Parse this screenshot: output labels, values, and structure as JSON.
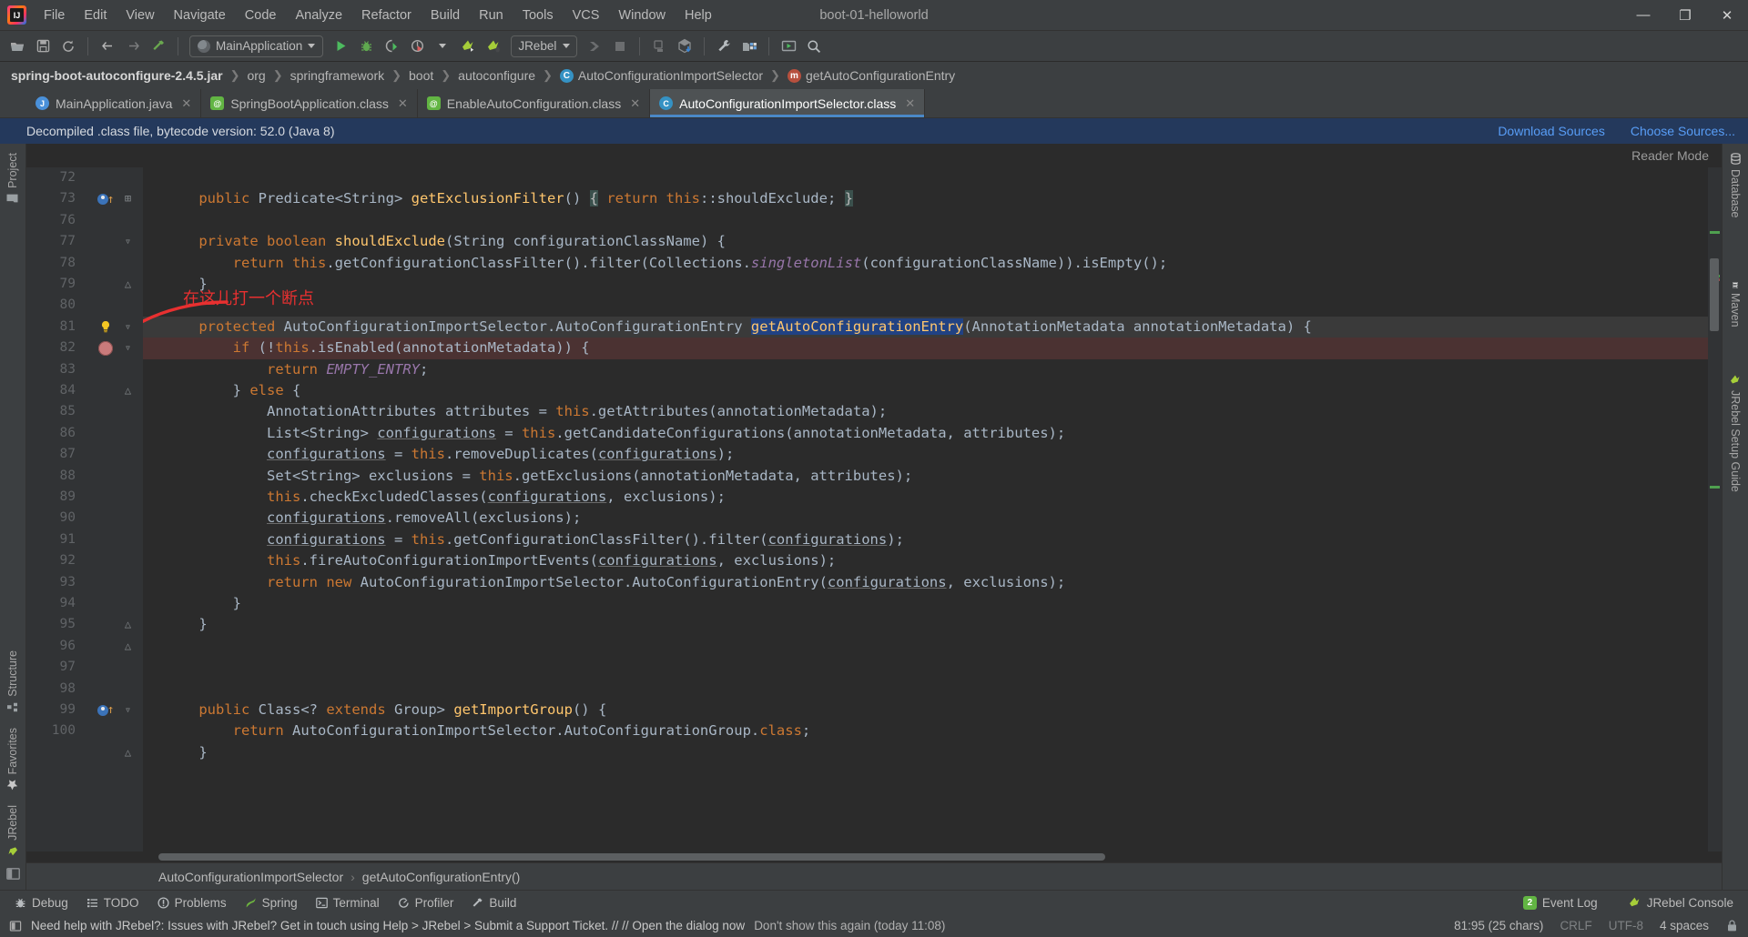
{
  "window": {
    "title": "boot-01-helloworld",
    "minimize": "—",
    "maximize": "❐",
    "close": "✕"
  },
  "menubar": [
    {
      "label": "File"
    },
    {
      "label": "Edit"
    },
    {
      "label": "View"
    },
    {
      "label": "Navigate"
    },
    {
      "label": "Code"
    },
    {
      "label": "Analyze"
    },
    {
      "label": "Refactor"
    },
    {
      "label": "Build"
    },
    {
      "label": "Run"
    },
    {
      "label": "Tools"
    },
    {
      "label": "VCS"
    },
    {
      "label": "Window"
    },
    {
      "label": "Help"
    }
  ],
  "toolbar": {
    "run_config": "MainApplication",
    "jrebel_label": "JRebel",
    "icons": [
      "open-folder-icon",
      "save-icon",
      "sync-icon",
      "back-arrow-icon",
      "forward-arrow-icon",
      "build-hammer-icon",
      "run-icon",
      "debug-icon",
      "run-coverage-icon",
      "profile-icon",
      "jrebel-run-icon",
      "jrebel-debug-icon",
      "rollback-icon",
      "stop-icon",
      "attach-icon",
      "update-app-icon",
      "settings-wrench-icon",
      "project-structure-icon",
      "select-opened-file-icon",
      "search-everywhere-icon"
    ]
  },
  "breadcrumb": [
    {
      "label": "spring-boot-autoconfigure-2.4.5.jar",
      "icon": "",
      "bold": true
    },
    {
      "label": "org",
      "icon": ""
    },
    {
      "label": "springframework",
      "icon": ""
    },
    {
      "label": "boot",
      "icon": ""
    },
    {
      "label": "autoconfigure",
      "icon": ""
    },
    {
      "label": "AutoConfigurationImportSelector",
      "icon": "class-badge"
    },
    {
      "label": "getAutoConfigurationEntry",
      "icon": "method-badge"
    }
  ],
  "tabs": [
    {
      "label": "MainApplication.java",
      "icon": "java-class-icon",
      "active": false,
      "close": "✕"
    },
    {
      "label": "SpringBootApplication.class",
      "icon": "annotation-icon",
      "active": false,
      "close": "✕"
    },
    {
      "label": "EnableAutoConfiguration.class",
      "icon": "annotation-icon",
      "active": false,
      "close": "✕"
    },
    {
      "label": "AutoConfigurationImportSelector.class",
      "icon": "class-icon",
      "active": true,
      "close": "✕"
    }
  ],
  "notice": {
    "text": "Decompiled .class file, bytecode version: 52.0 (Java 8)",
    "download_sources": "Download Sources",
    "choose_sources": "Choose Sources..."
  },
  "reader_mode": "Reader Mode",
  "annotation": {
    "text": "在这儿打一个断点",
    "color": "#e83030"
  },
  "editor": {
    "lines": [
      {
        "no": "72",
        "text": ""
      },
      {
        "no": "73",
        "text": "    public Predicate<String> getExclusionFilter() { return this::shouldExclude; }"
      },
      {
        "no": "76",
        "text": ""
      },
      {
        "no": "77",
        "text": "    private boolean shouldExclude(String configurationClassName) {"
      },
      {
        "no": "78",
        "text": "        return this.getConfigurationClassFilter().filter(Collections.singletonList(configurationClassName)).isEmpty();"
      },
      {
        "no": "79",
        "text": "    }"
      },
      {
        "no": "80",
        "text": ""
      },
      {
        "no": "81",
        "text": "    protected AutoConfigurationImportSelector.AutoConfigurationEntry getAutoConfigurationEntry(AnnotationMetadata annotationMetadata) {"
      },
      {
        "no": "82",
        "text": "        if (!this.isEnabled(annotationMetadata)) {"
      },
      {
        "no": "83",
        "text": "            return EMPTY_ENTRY;"
      },
      {
        "no": "84",
        "text": "        } else {"
      },
      {
        "no": "85",
        "text": "            AnnotationAttributes attributes = this.getAttributes(annotationMetadata);"
      },
      {
        "no": "86",
        "text": "            List<String> configurations = this.getCandidateConfigurations(annotationMetadata, attributes);"
      },
      {
        "no": "87",
        "text": "            configurations = this.removeDuplicates(configurations);"
      },
      {
        "no": "88",
        "text": "            Set<String> exclusions = this.getExclusions(annotationMetadata, attributes);"
      },
      {
        "no": "89",
        "text": "            this.checkExcludedClasses(configurations, exclusions);"
      },
      {
        "no": "90",
        "text": "            configurations.removeAll(exclusions);"
      },
      {
        "no": "91",
        "text": "            configurations = this.getConfigurationClassFilter().filter(configurations);"
      },
      {
        "no": "92",
        "text": "            this.fireAutoConfigurationImportEvents(configurations, exclusions);"
      },
      {
        "no": "93",
        "text": "            return new AutoConfigurationImportSelector.AutoConfigurationEntry(configurations, exclusions);"
      },
      {
        "no": "94",
        "text": "        }"
      },
      {
        "no": "95",
        "text": "    }"
      },
      {
        "no": "96",
        "text": ""
      },
      {
        "no": "97",
        "text": "    public Class<? extends Group> getImportGroup() {"
      },
      {
        "no": "98",
        "text": "        return AutoConfigurationImportSelector.AutoConfigurationGroup.class;"
      },
      {
        "no": "99",
        "text": "    }"
      },
      {
        "no": "100",
        "text": ""
      }
    ],
    "selected_token": "getAutoConfigurationEntry",
    "breakpoint_line": "82"
  },
  "nav_bottom": {
    "class": "AutoConfigurationImportSelector",
    "separator": "›",
    "method": "getAutoConfigurationEntry()"
  },
  "left_tools": [
    {
      "label": "Project",
      "icon": "project-folder-icon"
    },
    {
      "label": "Structure",
      "icon": "structure-icon"
    },
    {
      "label": "Favorites",
      "icon": "star-icon"
    },
    {
      "label": "JRebel",
      "icon": "jrebel-icon"
    }
  ],
  "right_tools": [
    {
      "label": "Database",
      "icon": "database-icon"
    },
    {
      "label": "Maven",
      "icon": "maven-icon"
    },
    {
      "label": "JRebel Setup Guide",
      "icon": "jrebel-icon"
    }
  ],
  "tool_windows": [
    {
      "label": "Debug",
      "icon": "debug-bug-icon"
    },
    {
      "label": "TODO",
      "icon": "todo-list-icon"
    },
    {
      "label": "Problems",
      "icon": "problems-icon"
    },
    {
      "label": "Spring",
      "icon": "spring-leaf-icon"
    },
    {
      "label": "Terminal",
      "icon": "terminal-icon"
    },
    {
      "label": "Profiler",
      "icon": "profiler-icon"
    },
    {
      "label": "Build",
      "icon": "build-hammer-icon"
    }
  ],
  "tool_windows_right": [
    {
      "label": "Event Log",
      "icon": "event-log-icon",
      "badge": "2"
    },
    {
      "label": "JRebel Console",
      "icon": "jrebel-icon",
      "badge": ""
    }
  ],
  "statusbar": {
    "message": "Need help with JRebel?: Issues with JRebel? Get in touch using Help > JRebel > Submit a Support Ticket. // // Open the dialog now",
    "dismiss": "Don't show this again (today 11:08)",
    "position": "81:95 (25 chars)",
    "line_sep": "CRLF",
    "encoding": "UTF-8",
    "indent": "4 spaces",
    "lock_icon": "lock-icon"
  },
  "colors": {
    "accent": "#4a88c7",
    "notice_bg": "#24395c",
    "link": "#589df6",
    "annotation_red": "#e83030",
    "editor_bg": "#2b2b2b",
    "chrome_bg": "#3c3f41"
  }
}
